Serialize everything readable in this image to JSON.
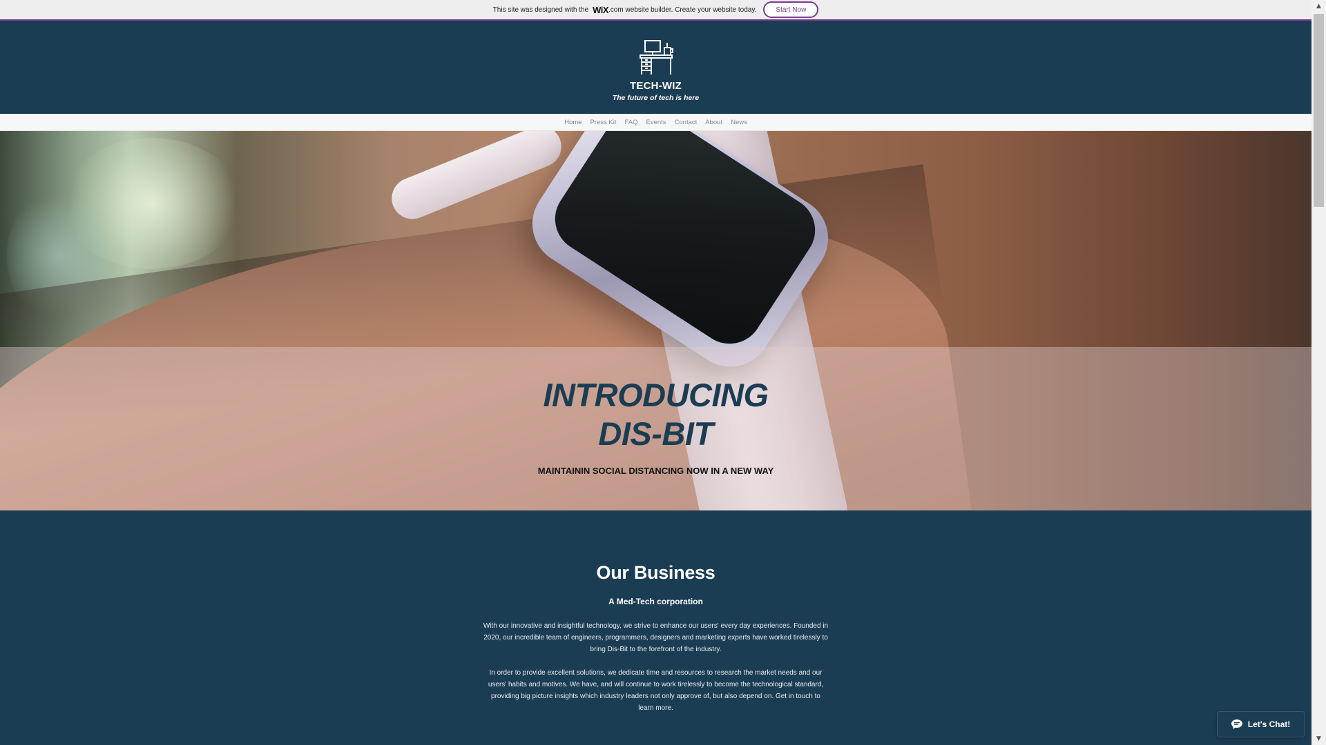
{
  "wix_banner": {
    "text_before": "This site was designed with the",
    "logo_text": "WiX",
    "text_after": ".com website builder. Create your website today.",
    "button_label": "Start Now"
  },
  "header": {
    "logo_icon": "desk-computer-icon",
    "title": "TECH-WIZ",
    "tagline": "The future of tech is here"
  },
  "nav": {
    "items": [
      {
        "label": "Home"
      },
      {
        "label": "Press Kit"
      },
      {
        "label": "FAQ"
      },
      {
        "label": "Events"
      },
      {
        "label": "Contact"
      },
      {
        "label": "About"
      },
      {
        "label": "News"
      }
    ]
  },
  "hero": {
    "headline_line1": "INTRODUCING",
    "headline_line2": "DIS-BIT",
    "subheading": "MAINTAININ SOCIAL DISTANCING NOW IN A NEW WAY",
    "image_subject": "smartwatch-on-wrist"
  },
  "business": {
    "title": "Our Business",
    "subtitle": "A Med-Tech corporation",
    "paragraph1": "With our innovative and insightful technology, we strive to enhance our users' every day experiences. Founded in 2020, our incredible team of engineers, programmers, designers and marketing experts have worked tirelessly to bring Dis-Bit to the forefront of the industry.",
    "paragraph2": "In order to provide excellent solutions, we dedicate time and resources to research the market needs and our users' habits and motives. We have, and will continue to work tirelessly to become the technological standard, providing big picture insights which industry leaders not only approve of, but also depend on. Get in touch to learn more."
  },
  "chat": {
    "label": "Let's Chat!",
    "icon": "chat-bubble-icon"
  },
  "colors": {
    "brand_navy": "#1b3d54",
    "wix_purple": "#7a3b8f",
    "nav_bg": "#f7f7f7"
  }
}
